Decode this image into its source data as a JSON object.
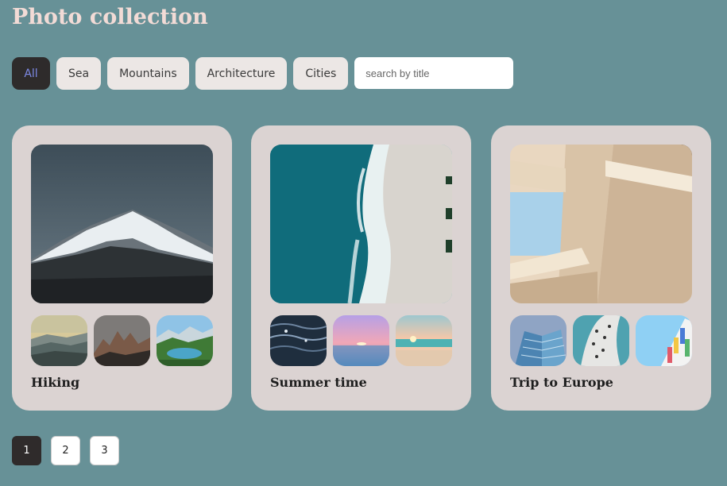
{
  "header": {
    "title": "Photo collection"
  },
  "filters": [
    {
      "label": "All",
      "active": true
    },
    {
      "label": "Sea"
    },
    {
      "label": "Mountains"
    },
    {
      "label": "Architecture"
    },
    {
      "label": "Cities"
    }
  ],
  "search": {
    "placeholder": "search by title",
    "value": ""
  },
  "cards": [
    {
      "title": "Hiking",
      "hero": "snowy-mountain-photo",
      "thumbs": [
        "misty-hills-photo",
        "rocky-peaks-photo",
        "alpine-lake-photo"
      ]
    },
    {
      "title": "Summer time",
      "hero": "aerial-beach-waves-photo",
      "thumbs": [
        "dark-sea-photo",
        "pink-sunset-sea-photo",
        "beach-sunset-photo"
      ]
    },
    {
      "title": "Trip to Europe",
      "hero": "modern-building-photo",
      "thumbs": [
        "glass-tower-photo",
        "curved-facade-photo",
        "colorful-balconies-photo"
      ]
    }
  ],
  "pagination": {
    "pages": [
      "1",
      "2",
      "3"
    ],
    "current": "1"
  },
  "colors": {
    "background": "#679197",
    "card": "#dbd3d2",
    "title": "#f2dbd6",
    "active_button": "#2e2b2b",
    "active_text": "#7e8ae6"
  }
}
